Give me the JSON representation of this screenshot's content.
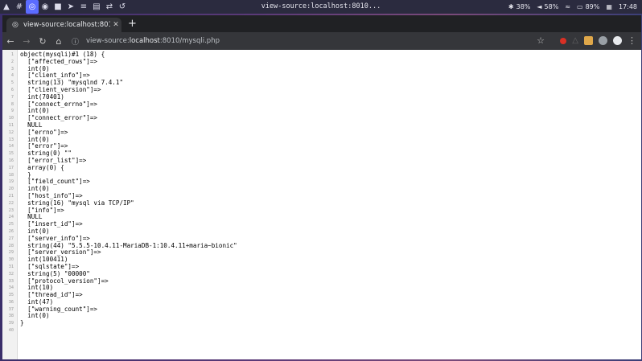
{
  "system_panel": {
    "window_title": "view-source:localhost:8010...",
    "brightness": "38%",
    "volume": "58%",
    "battery": "89%",
    "clock": "17:48"
  },
  "browser": {
    "tab_title": "view-source:localhost:801",
    "tab_close": "✕",
    "new_tab": "+",
    "url_prefix": "view-source:",
    "url_host": "localhost",
    "url_rest": ":8010/mysqli.php"
  },
  "source_lines": [
    "object(mysqli)#1 (18) {",
    "  [\"affected_rows\"]=>",
    "  int(0)",
    "  [\"client_info\"]=>",
    "  string(13) \"mysqlnd 7.4.1\"",
    "  [\"client_version\"]=>",
    "  int(70401)",
    "  [\"connect_errno\"]=>",
    "  int(0)",
    "  [\"connect_error\"]=>",
    "  NULL",
    "  [\"errno\"]=>",
    "  int(0)",
    "  [\"error\"]=>",
    "  string(0) \"\"",
    "  [\"error_list\"]=>",
    "  array(0) {",
    "  }",
    "  [\"field_count\"]=>",
    "  int(0)",
    "  [\"host_info\"]=>",
    "  string(16) \"mysql via TCP/IP\"",
    "  [\"info\"]=>",
    "  NULL",
    "  [\"insert_id\"]=>",
    "  int(0)",
    "  [\"server_info\"]=>",
    "  string(44) \"5.5.5-10.4.11-MariaDB-1:10.4.11+maria~bionic\"",
    "  [\"server_version\"]=>",
    "  int(100411)",
    "  [\"sqlstate\"]=>",
    "  string(5) \"00000\"",
    "  [\"protocol_version\"]=>",
    "  int(10)",
    "  [\"thread_id\"]=>",
    "  int(47)",
    "  [\"warning_count\"]=>",
    "  int(0)",
    "}",
    ""
  ]
}
